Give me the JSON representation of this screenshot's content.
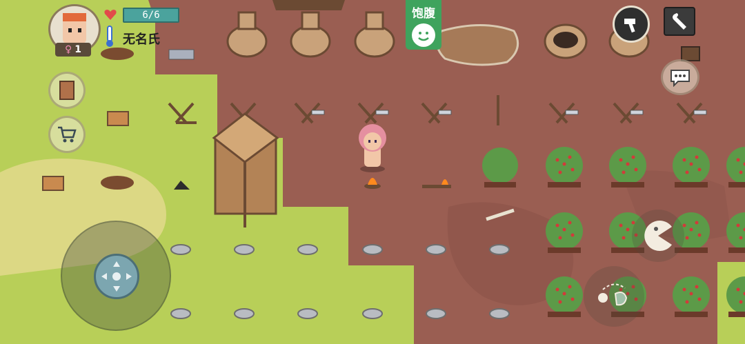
{
  "player": {
    "name": "无名氏",
    "health": "6/6",
    "gender_symbol": "♀",
    "generation": "1"
  },
  "hunger": {
    "label": "饱腹"
  },
  "icons": {
    "settings": "wrench-icon",
    "build": "hammer-icon",
    "chat": "speech-bubble-icon",
    "journal": "book-icon",
    "shop": "cart-icon",
    "eat": "pacman-eat-icon",
    "throw": "throw-hand-icon",
    "health": "heart-icon",
    "temperature": "thermometer-icon"
  },
  "colors": {
    "grass": "#b8cf58",
    "dirt": "#9a5e52",
    "health_bar": "#4ba39d",
    "hunger_panel": "#3fa35d"
  }
}
